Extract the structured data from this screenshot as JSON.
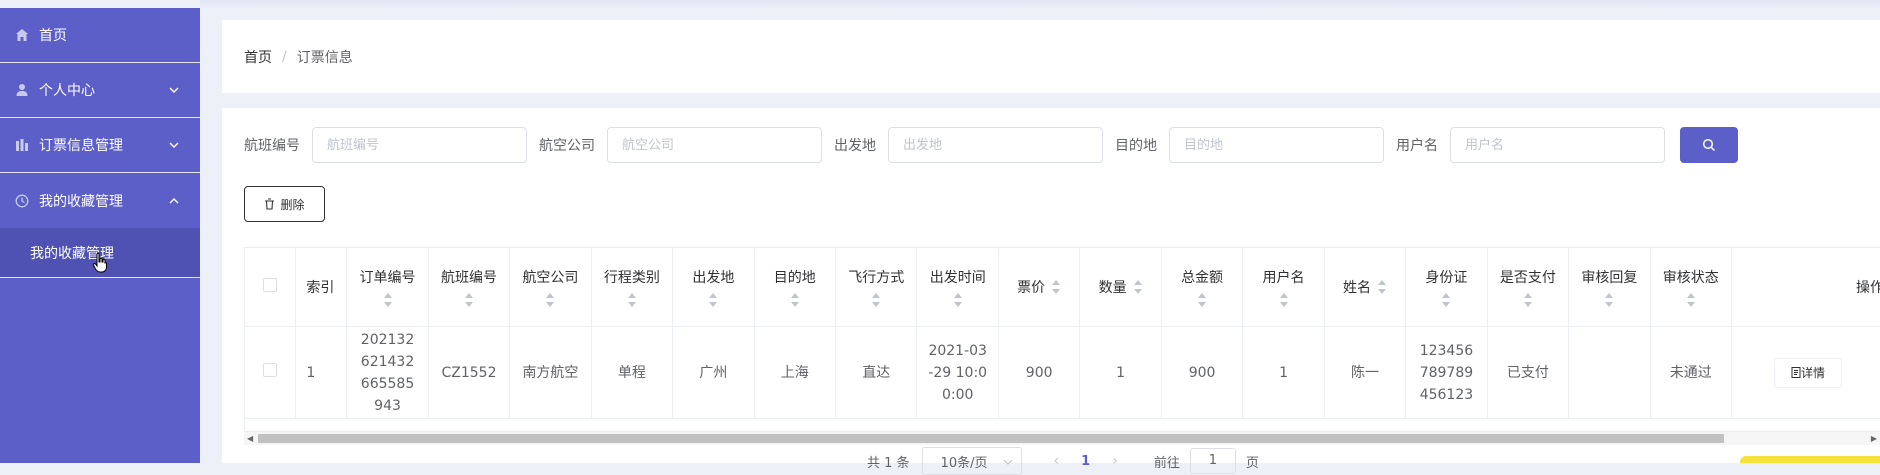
{
  "sidebar": {
    "items": [
      {
        "label": "首页",
        "icon": "home-icon"
      },
      {
        "label": "个人中心",
        "icon": "user-icon"
      },
      {
        "label": "订票信息管理",
        "icon": "chart-icon"
      },
      {
        "label": "我的收藏管理",
        "icon": "clock-icon"
      }
    ],
    "sub_items": [
      {
        "label": "我的收藏管理"
      }
    ]
  },
  "breadcrumb": {
    "home": "首页",
    "separator": "/",
    "current": "订票信息"
  },
  "search": {
    "fields": [
      {
        "label": "航班编号",
        "placeholder": "航班编号"
      },
      {
        "label": "航空公司",
        "placeholder": "航空公司"
      },
      {
        "label": "出发地",
        "placeholder": "出发地"
      },
      {
        "label": "目的地",
        "placeholder": "目的地"
      },
      {
        "label": "用户名",
        "placeholder": "用户名"
      }
    ]
  },
  "toolbar": {
    "delete_label": "删除"
  },
  "table": {
    "headers": [
      "索引",
      "订单编号",
      "航班编号",
      "航空公司",
      "行程类别",
      "出发地",
      "目的地",
      "飞行方式",
      "出发时间",
      "票价",
      "数量",
      "总金额",
      "用户名",
      "姓名",
      "身份证",
      "是否支付",
      "审核回复",
      "审核状态",
      "操作"
    ],
    "rows": [
      {
        "index": "1",
        "order_no": "202132621432665585943",
        "flight_no": "CZ1552",
        "airline": "南方航空",
        "trip_type": "单程",
        "origin": "广州",
        "destination": "上海",
        "flight_mode": "直达",
        "depart_time": "2021-03-29 10:00:00",
        "price": "900",
        "quantity": "1",
        "total": "900",
        "username": "1",
        "name": "陈一",
        "id_card": "123456789789456123",
        "paid": "已支付",
        "review_reply": "",
        "review_status": "未通过",
        "action_label": "详情"
      }
    ]
  },
  "pagination": {
    "total_text": "共 1 条",
    "page_size": "10条/页",
    "current_page": "1",
    "goto_prefix": "前往",
    "goto_value": "1",
    "goto_suffix": "页"
  },
  "colors": {
    "accent": "#5b5fc7",
    "sidebar_sub": "#4f52b2"
  }
}
